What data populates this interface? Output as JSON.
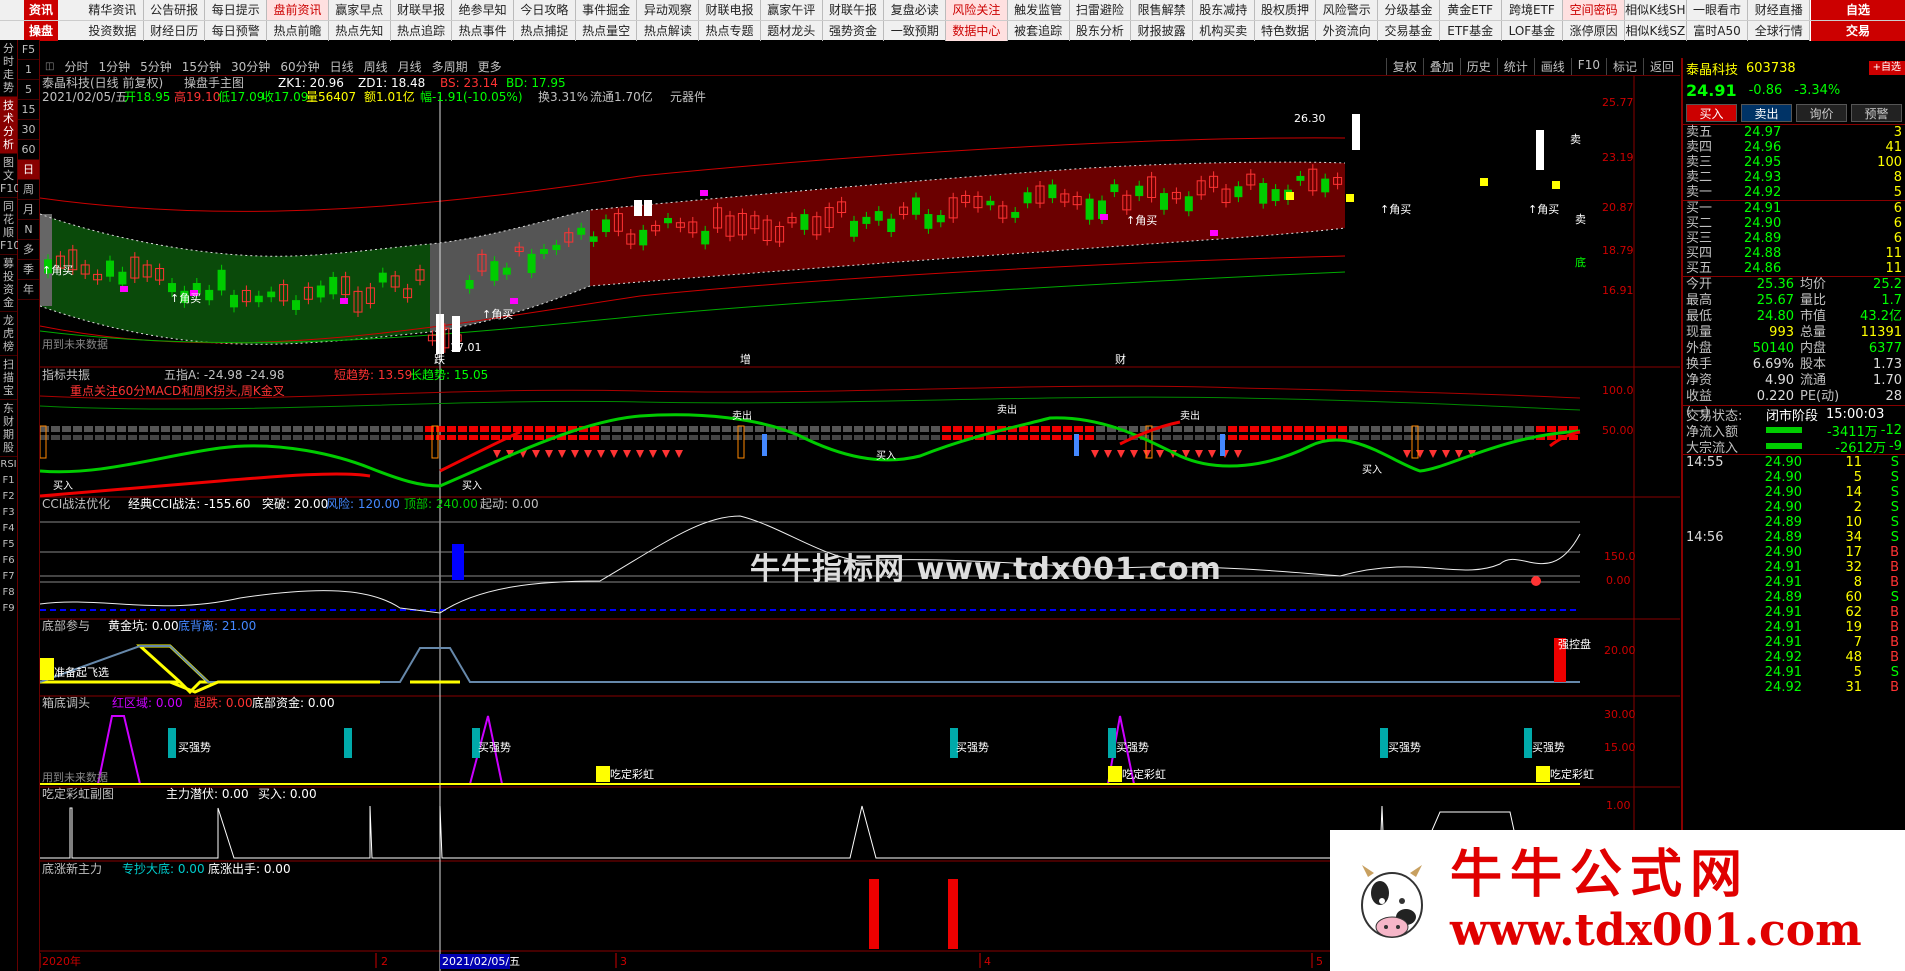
{
  "topbar": {
    "brand_row1": "资讯",
    "brand_row2": "操盘",
    "nav_row1": [
      "精华资讯",
      "公告研报",
      "每日提示",
      "盘前资讯",
      "赢家早点",
      "财联早报",
      "绝参早知",
      "今日攻略",
      "事件掘金",
      "异动观察",
      "财联电报",
      "赢家午评",
      "财联午报",
      "复盘必读",
      "风险关注",
      "触发监管",
      "扫雷避险",
      "限售解禁",
      "股东减持",
      "股权质押",
      "风险警示",
      "分级基金",
      "黄金ETF",
      "跨境ETF",
      "空间密码",
      "相似K线SH",
      "一眼看市",
      "财经直播"
    ],
    "nav_row2": [
      "投资数据",
      "财经日历",
      "每日预警",
      "热点前瞻",
      "热点先知",
      "热点追踪",
      "热点事件",
      "热点捕捉",
      "热点量空",
      "热点解读",
      "热点专题",
      "题材龙头",
      "强势资金",
      "一致预期",
      "数据中心",
      "被套追踪",
      "股东分析",
      "财报披露",
      "机构买卖",
      "特色数据",
      "外资流向",
      "交易基金",
      "ETF基金",
      "LOF基金",
      "涨停原因",
      "相似K线SZ",
      "富时A50",
      "全球行情"
    ],
    "right_row1": "自选",
    "right_row2": "交易"
  },
  "leftbar": {
    "items": [
      "分时走势",
      "技术分析",
      "图文F10",
      "同花顺F10",
      "募投资金",
      "龙虎榜",
      "扫描宝",
      "东财期股"
    ],
    "icons": [
      "RSI",
      "F1",
      "F2",
      "F3",
      "F4",
      "F5",
      "F6",
      "F7",
      "F8",
      "F9"
    ]
  },
  "leftbar2": {
    "items": [
      "F5",
      "1",
      "5",
      "15",
      "30",
      "60",
      "日",
      "周",
      "月",
      "N",
      "多",
      "季",
      "年"
    ]
  },
  "period": {
    "items": [
      "分时",
      "1分钟",
      "5分钟",
      "15分钟",
      "30分钟",
      "60分钟",
      "日线",
      "周线",
      "月线",
      "多周期",
      "更多"
    ],
    "tools": [
      "复权",
      "叠加",
      "历史",
      "统计",
      "画线",
      "F10",
      "标记",
      "返回"
    ]
  },
  "header_main": {
    "stock": "泰晶科技(日线 前复权)",
    "indicator": "操盘手主图",
    "zk1": "ZK1: 20.96",
    "zd1": "ZD1: 18.48",
    "bs": "BS: 23.14",
    "bd": "BD: 17.95",
    "date_line": "2021/02/05/五",
    "open": "开18.95",
    "high": "高19.10",
    "low": "低17.09",
    "close": "收17.09",
    "vol": "量56407",
    "amt": "额1.01亿",
    "chg": "幅-1.91(-10.05%)",
    "turn": "换3.31%",
    "float": "流通1.70亿",
    "sector": "元器件",
    "future_hint": "用到未来数据",
    "hi_label": "26.30",
    "lo_label": "17.01"
  },
  "price_axis": [
    "25.77",
    "23.19",
    "20.87",
    "18.79",
    "16.91"
  ],
  "marks": {
    "buy": "↑角买",
    "sell_box": "卖",
    "bottom": "底",
    "die": "跌",
    "zeng": "增",
    "cai": "财"
  },
  "panel2": {
    "title": "指标共振",
    "a_label": "五指A: -24.98",
    "a_val": ": -24.98",
    "short_trend": "短趋势: 13.59",
    "long_trend": "长趋势: 15.05",
    "note": "重点关注60分MACD和周K拐头,周K金叉",
    "axis": [
      "100.0",
      "50.00"
    ],
    "buy": "买入",
    "sell": "卖出"
  },
  "panel3": {
    "title": "CCI战法优化",
    "cci": "经典CCI战法: -155.60",
    "tupo": "突破: 20.00",
    "fengxian": "风险: 120.00",
    "dingbu": "顶部: 240.00",
    "qidong": "起动: 0.00",
    "axis": [
      "150.0",
      "0.00"
    ]
  },
  "panel4": {
    "title": "底部参与",
    "gold": "黄金坑: 0.00",
    "div": "底背离: 21.00",
    "label_left": "准备起飞选",
    "label_right": "强控盘",
    "axis": [
      "20.00"
    ]
  },
  "panel5": {
    "title": "箱底调头",
    "red": "红区域: 0.00",
    "chao": "超跌: 0.00",
    "fund": "底部资金: 0.00",
    "strong": "买强势",
    "rainbow": "吃定彩虹",
    "future": "用到未来数据",
    "axis": [
      "30.00",
      "15.00"
    ]
  },
  "panel6": {
    "title": "吃定彩虹副图",
    "main": "主力潜伏: 0.00",
    "buy": "买入: 0.00",
    "axis": [
      "1.00"
    ]
  },
  "panel7": {
    "title": "底涨新主力",
    "zhuan": "专抄大底: 0.00",
    "dz": "底涨出手: 0.00"
  },
  "date_axis": {
    "year": "2020年",
    "m2": "2",
    "cursor": "2021/02/05/五",
    "m3": "3",
    "m4": "4",
    "m5": "5"
  },
  "right_panel": {
    "name": "泰晶科技",
    "code": "603738",
    "badge": "+自选",
    "price": "24.91",
    "change": "-0.86",
    "pct": "-3.34%",
    "buttons": [
      "买入",
      "卖出",
      "询价",
      "预警"
    ],
    "asks": [
      {
        "l": "卖五",
        "p": "24.97",
        "q": "3"
      },
      {
        "l": "卖四",
        "p": "24.96",
        "q": "41"
      },
      {
        "l": "卖三",
        "p": "24.95",
        "q": "100"
      },
      {
        "l": "卖二",
        "p": "24.93",
        "q": "8"
      },
      {
        "l": "卖一",
        "p": "24.92",
        "q": "5"
      }
    ],
    "bids": [
      {
        "l": "买一",
        "p": "24.91",
        "q": "6"
      },
      {
        "l": "买二",
        "p": "24.90",
        "q": "6"
      },
      {
        "l": "买三",
        "p": "24.89",
        "q": "6"
      },
      {
        "l": "买四",
        "p": "24.88",
        "q": "11"
      },
      {
        "l": "买五",
        "p": "24.86",
        "q": "11"
      }
    ],
    "quote": [
      {
        "l": "今开",
        "v": "25.36",
        "l2": "均价",
        "v2": "25.2"
      },
      {
        "l": "最高",
        "v": "25.67",
        "l2": "量比",
        "v2": "1.7"
      },
      {
        "l": "最低",
        "v": "24.80",
        "l2": "市值",
        "v2": "43.2亿"
      },
      {
        "l": "现量",
        "v": "993",
        "l2": "总量",
        "v2": "11391"
      },
      {
        "l": "外盘",
        "v": "50140",
        "l2": "内盘",
        "v2": "6377"
      },
      {
        "l": "换手",
        "v": "6.69%",
        "l2": "股本",
        "v2": "1.73"
      },
      {
        "l": "净资",
        "v": "4.90",
        "l2": "流通",
        "v2": "1.70"
      },
      {
        "l": "收益(一)",
        "v": "0.220",
        "l2": "PE(动)",
        "v2": "28"
      }
    ],
    "state_label": "交易状态:",
    "state_val": "闭市阶段",
    "state_time": "15:00:03",
    "net_in_label": "净流入额",
    "net_in_val": "-3411万",
    "net_in_extra": "-12",
    "big_in_label": "大宗流入",
    "big_in_val": "-2612万",
    "big_in_extra": "-9",
    "ticks": [
      {
        "t": "14:55",
        "p": "24.90",
        "v": "11",
        "bs": "S"
      },
      {
        "t": "",
        "p": "24.90",
        "v": "5",
        "bs": "S"
      },
      {
        "t": "",
        "p": "24.90",
        "v": "14",
        "bs": "S"
      },
      {
        "t": "",
        "p": "24.90",
        "v": "2",
        "bs": "S"
      },
      {
        "t": "",
        "p": "24.89",
        "v": "10",
        "bs": "S"
      },
      {
        "t": "14:56",
        "p": "24.89",
        "v": "34",
        "bs": "S"
      },
      {
        "t": "",
        "p": "24.90",
        "v": "17",
        "bs": "B"
      },
      {
        "t": "",
        "p": "24.91",
        "v": "32",
        "bs": "B"
      },
      {
        "t": "",
        "p": "24.91",
        "v": "8",
        "bs": "B"
      },
      {
        "t": "",
        "p": "24.89",
        "v": "60",
        "bs": "S"
      },
      {
        "t": "",
        "p": "24.91",
        "v": "62",
        "bs": "B"
      },
      {
        "t": "",
        "p": "24.91",
        "v": "19",
        "bs": "B"
      },
      {
        "t": "",
        "p": "24.91",
        "v": "7",
        "bs": "B"
      },
      {
        "t": "",
        "p": "24.92",
        "v": "48",
        "bs": "B"
      },
      {
        "t": "",
        "p": "24.91",
        "v": "5",
        "bs": "S"
      },
      {
        "t": "",
        "p": "24.92",
        "v": "31",
        "bs": "B"
      }
    ]
  },
  "watermark": {
    "mid": "牛牛指标网 www.tdx001.com",
    "big_cn": "牛牛公式网",
    "big_url": "www.tdx001.com"
  }
}
